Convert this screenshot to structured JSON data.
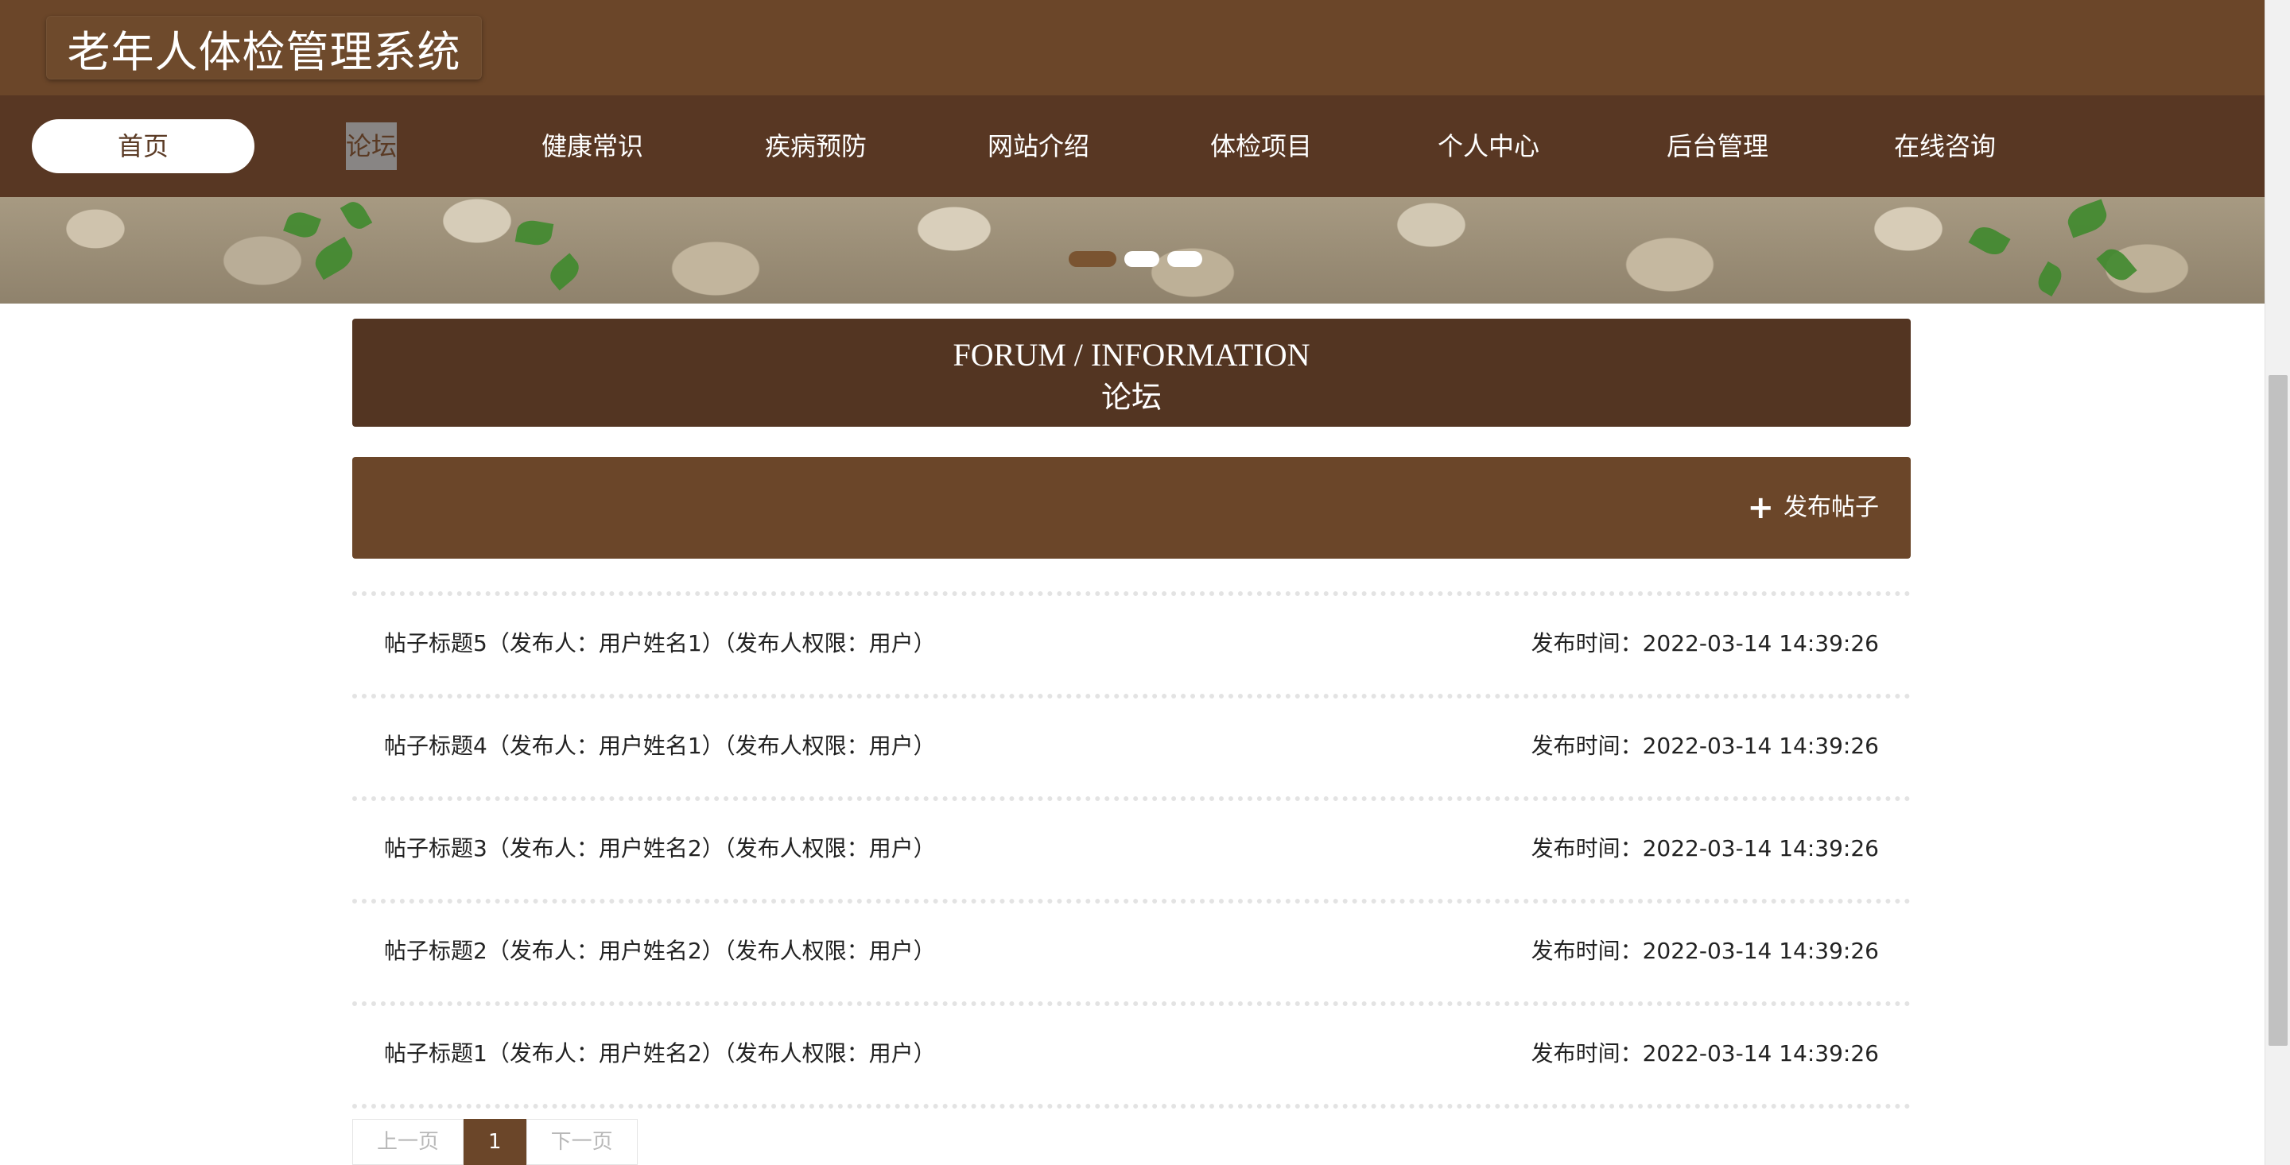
{
  "header": {
    "site_title": "老年人体检管理系统"
  },
  "nav": {
    "items": [
      {
        "label": "首页"
      },
      {
        "label": "论坛"
      },
      {
        "label": "健康常识"
      },
      {
        "label": "疾病预防"
      },
      {
        "label": "网站介绍"
      },
      {
        "label": "体检项目"
      },
      {
        "label": "个人中心"
      },
      {
        "label": "后台管理"
      },
      {
        "label": "在线咨询"
      }
    ]
  },
  "section": {
    "title_en": "FORUM / INFORMATION",
    "title_zh": "论坛"
  },
  "actions": {
    "publish_label": "发布帖子",
    "publish_icon": "plus-icon"
  },
  "posts": [
    {
      "title": "帖子标题5（发布人：用户姓名1）（发布人权限：用户）",
      "time": "发布时间：2022-03-14 14:39:26"
    },
    {
      "title": "帖子标题4（发布人：用户姓名1）（发布人权限：用户）",
      "time": "发布时间：2022-03-14 14:39:26"
    },
    {
      "title": "帖子标题3（发布人：用户姓名2）（发布人权限：用户）",
      "time": "发布时间：2022-03-14 14:39:26"
    },
    {
      "title": "帖子标题2（发布人：用户姓名2）（发布人权限：用户）",
      "time": "发布时间：2022-03-14 14:39:26"
    },
    {
      "title": "帖子标题1（发布人：用户姓名2）（发布人权限：用户）",
      "time": "发布时间：2022-03-14 14:39:26"
    }
  ],
  "pagination": {
    "prev": "上一页",
    "current": "1",
    "next": "下一页"
  },
  "colors": {
    "brand": "#6b4629",
    "nav_bg": "#583723",
    "title_bg": "#533522"
  }
}
